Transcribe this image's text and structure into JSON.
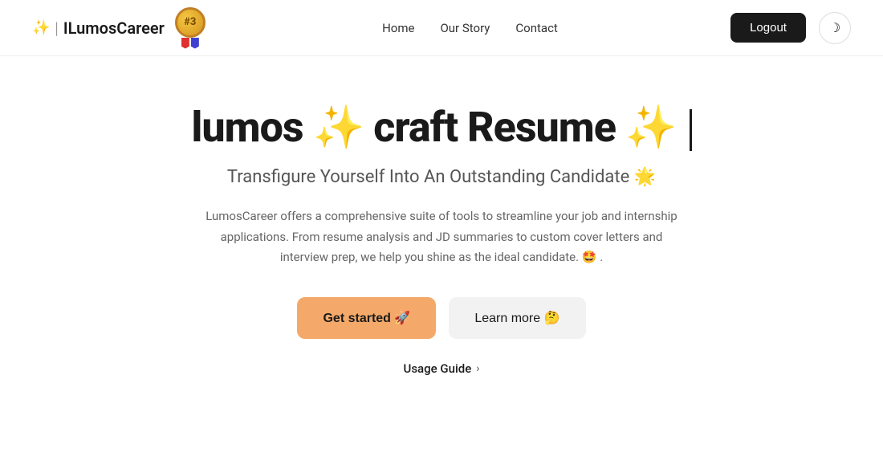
{
  "brand": {
    "name": "ILumosCareer",
    "wand": "✨",
    "medal_number": "#3"
  },
  "nav": {
    "home": "Home",
    "our_story": "Our Story",
    "contact": "Contact",
    "logout": "Logout"
  },
  "hero": {
    "title_part1": "lumos",
    "title_emoji1": "✨",
    "title_part2": "craft Resume",
    "title_emoji2": "✨",
    "subtitle": "Transfigure Yourself Into An Outstanding Candidate 🌟",
    "description": "LumosCareer offers a comprehensive suite of tools to streamline your job and internship applications. From resume analysis and JD summaries to custom cover letters and interview prep, we help you shine as the ideal candidate. 🤩 .",
    "btn_primary": "Get started 🚀",
    "btn_secondary": "Learn more 🤔",
    "usage_guide": "Usage Guide"
  },
  "theme_toggle_icon": "☽"
}
